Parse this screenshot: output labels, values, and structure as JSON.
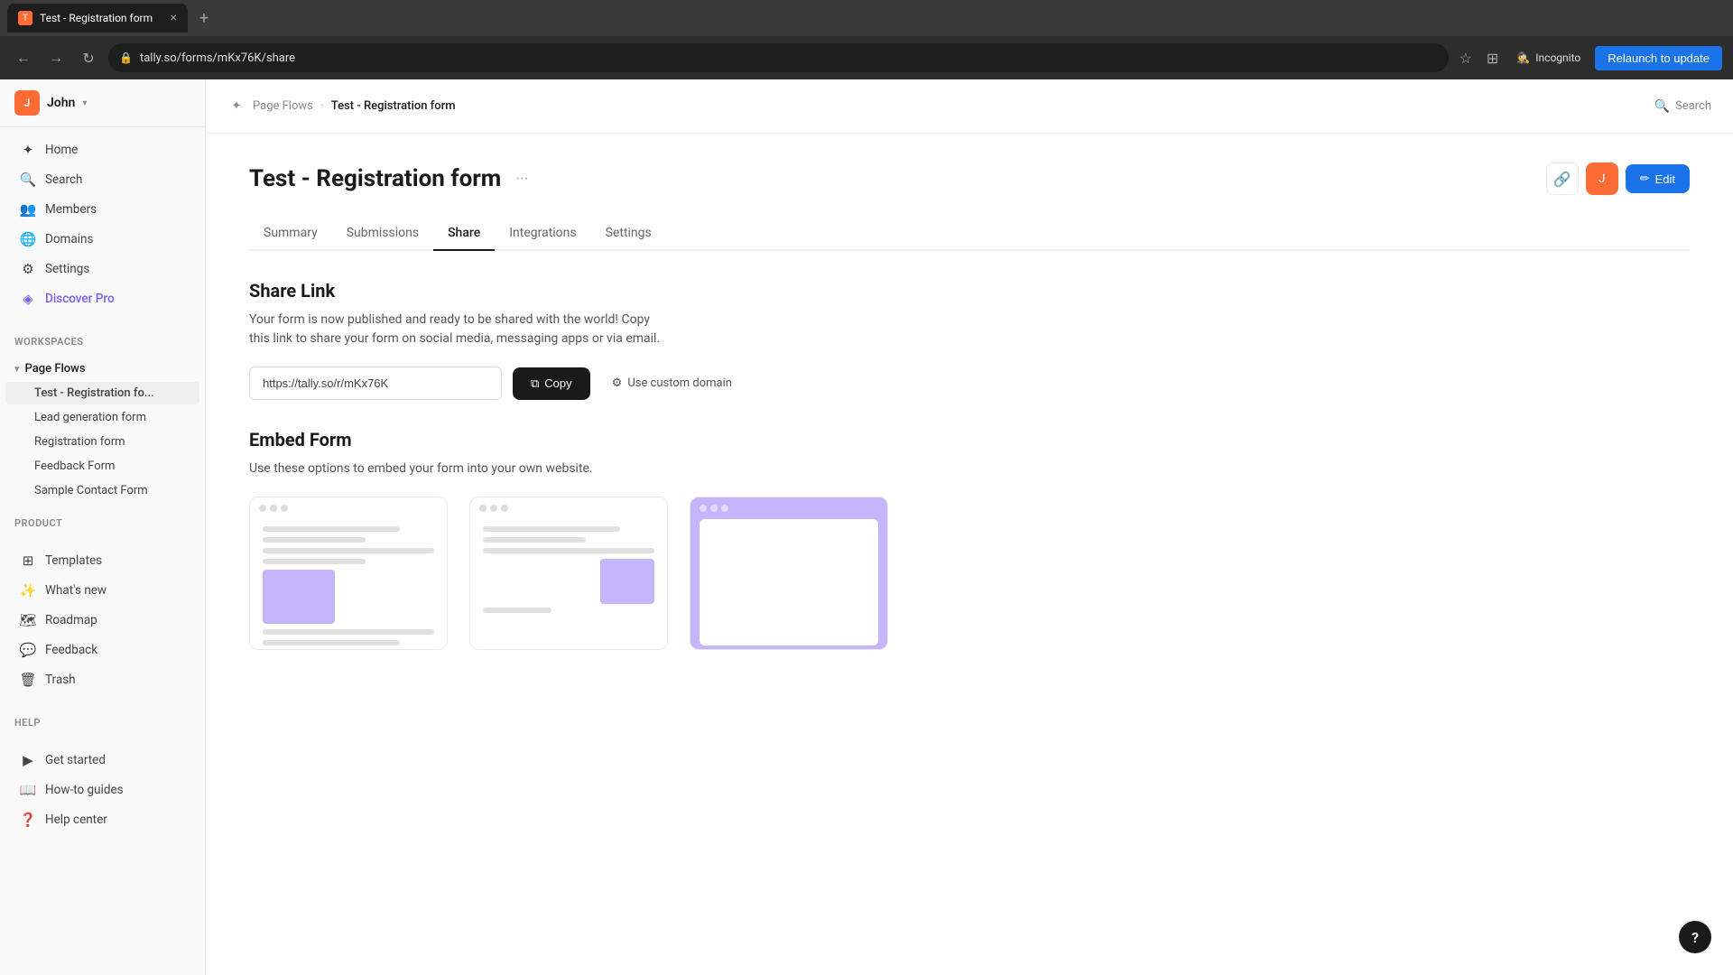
{
  "browser": {
    "tab": {
      "favicon": "T",
      "title": "Test - Registration form",
      "close_icon": "×"
    },
    "new_tab_icon": "+",
    "nav": {
      "back_icon": "←",
      "forward_icon": "→",
      "reload_icon": "↻",
      "url": "tally.so/forms/mKx76K/share",
      "bookmark_icon": "☆",
      "extensions_icon": "⊞",
      "incognito_icon": "🕵",
      "incognito_label": "Incognito",
      "relaunch_label": "Relaunch to update"
    }
  },
  "sidebar": {
    "user": {
      "initial": "J",
      "name": "John",
      "chevron": "▾"
    },
    "main_nav": [
      {
        "id": "home",
        "icon": "✦",
        "label": "Home"
      },
      {
        "id": "search",
        "icon": "🔍",
        "label": "Search"
      },
      {
        "id": "members",
        "icon": "👥",
        "label": "Members"
      },
      {
        "id": "domains",
        "icon": "🌐",
        "label": "Domains"
      },
      {
        "id": "settings",
        "icon": "⚙",
        "label": "Settings"
      },
      {
        "id": "discover-pro",
        "icon": "◈",
        "label": "Discover Pro"
      }
    ],
    "workspaces_label": "Workspaces",
    "workspace": {
      "name": "Page Flows",
      "chevron": "▾"
    },
    "workspace_items": [
      {
        "id": "test-reg",
        "label": "Test - Registration fo..."
      },
      {
        "id": "lead-gen",
        "label": "Lead generation form"
      },
      {
        "id": "registration",
        "label": "Registration form"
      },
      {
        "id": "feedback-form",
        "label": "Feedback Form"
      },
      {
        "id": "sample-contact",
        "label": "Sample Contact Form"
      }
    ],
    "product_label": "Product",
    "product_nav": [
      {
        "id": "templates",
        "icon": "⊞",
        "label": "Templates"
      },
      {
        "id": "whats-new",
        "icon": "✨",
        "label": "What's new"
      },
      {
        "id": "roadmap",
        "icon": "🗺",
        "label": "Roadmap"
      },
      {
        "id": "feedback",
        "icon": "💬",
        "label": "Feedback"
      },
      {
        "id": "trash",
        "icon": "🗑",
        "label": "Trash"
      }
    ],
    "help_label": "Help",
    "help_nav": [
      {
        "id": "get-started",
        "icon": "▶",
        "label": "Get started"
      },
      {
        "id": "how-to",
        "icon": "📖",
        "label": "How-to guides"
      },
      {
        "id": "help-center",
        "icon": "❓",
        "label": "Help center"
      }
    ]
  },
  "topbar": {
    "breadcrumb": {
      "icon": "✦",
      "workspace": "Page Flows",
      "sep": "›",
      "current": "Test - Registration form"
    },
    "search_label": "Search",
    "search_icon": "🔍"
  },
  "page": {
    "title": "Test - Registration form",
    "title_menu": "···",
    "tabs": [
      {
        "id": "summary",
        "label": "Summary"
      },
      {
        "id": "submissions",
        "label": "Submissions"
      },
      {
        "id": "share",
        "label": "Share"
      },
      {
        "id": "integrations",
        "label": "Integrations"
      },
      {
        "id": "settings",
        "label": "Settings"
      }
    ],
    "active_tab": "share",
    "edit_label": "Edit",
    "share": {
      "section_title": "Share Link",
      "description_line1": "Your form is now published and ready to be shared with the world! Copy",
      "description_line2": "this link to share your form on social media, messaging apps or via email.",
      "link_url": "https://tally.so/r/mKx76K",
      "copy_label": "Copy",
      "custom_domain_label": "Use custom domain",
      "embed_title": "Embed Form",
      "embed_description": "Use these options to embed your form into your own website."
    },
    "help_icon": "?"
  },
  "colors": {
    "accent": "#1a73e8",
    "brand_orange": "#ff6b35",
    "purple": "#7c5cfc",
    "embed_purple": "#c4b5fd",
    "text_dark": "#1a1a1a",
    "text_muted": "#888"
  }
}
